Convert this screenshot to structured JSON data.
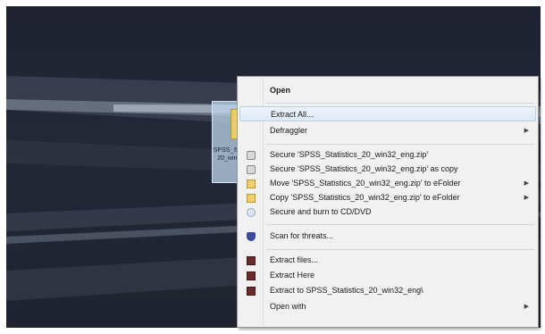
{
  "file": {
    "name": "SPSS_Statistics_20_win32_eng"
  },
  "context_menu": {
    "items": [
      {
        "label": "Open",
        "icon": "",
        "submenu": false
      },
      {
        "label": "Extract All...",
        "icon": "",
        "submenu": false
      },
      {
        "label": "Defraggler",
        "icon": "",
        "submenu": true
      },
      {
        "label": "Secure 'SPSS_Statistics_20_win32_eng.zip'",
        "icon": "lock-icon",
        "submenu": false
      },
      {
        "label": "Secure 'SPSS_Statistics_20_win32_eng.zip' as copy",
        "icon": "lock-icon",
        "submenu": false
      },
      {
        "label": "Move 'SPSS_Statistics_20_win32_eng.zip' to eFolder",
        "icon": "folder-icon",
        "submenu": true
      },
      {
        "label": "Copy 'SPSS_Statistics_20_win32_eng.zip' to eFolder",
        "icon": "folder-icon",
        "submenu": true
      },
      {
        "label": "Secure and burn to CD/DVD",
        "icon": "disc-icon",
        "submenu": false
      },
      {
        "label": "Scan for threats...",
        "icon": "shield-icon",
        "submenu": false
      },
      {
        "label": "Extract files...",
        "icon": "winrar-icon",
        "submenu": false
      },
      {
        "label": "Extract Here",
        "icon": "winrar-icon",
        "submenu": false
      },
      {
        "label": "Extract to SPSS_Statistics_20_win32_eng\\",
        "icon": "winrar-icon",
        "submenu": false
      },
      {
        "label": "Open with",
        "icon": "",
        "submenu": true
      }
    ],
    "submenu_arrow": "▶"
  }
}
